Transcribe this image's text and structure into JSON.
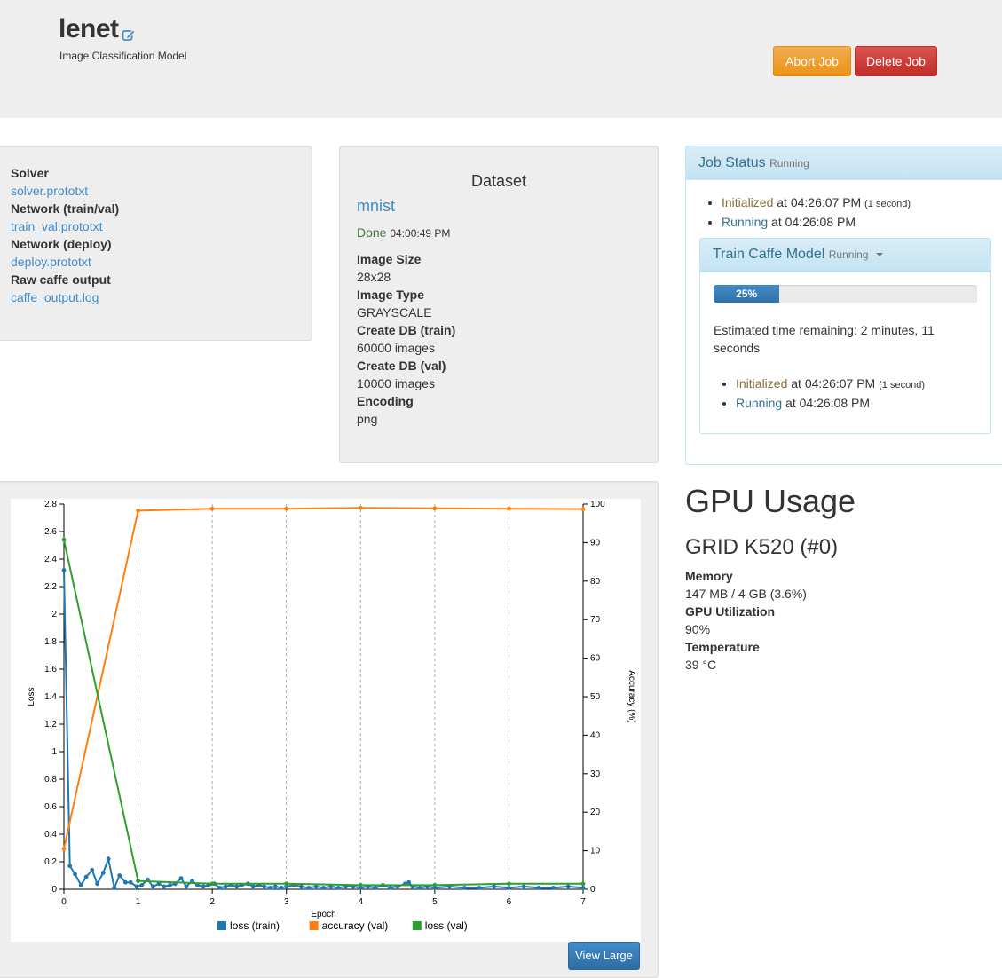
{
  "header": {
    "title": "lenet",
    "subtitle": "Image Classification Model",
    "abort_label": "Abort Job",
    "delete_label": "Delete Job"
  },
  "files": [
    {
      "label": "Solver",
      "link": "solver.prototxt"
    },
    {
      "label": "Network (train/val)",
      "link": "train_val.prototxt"
    },
    {
      "label": "Network (deploy)",
      "link": "deploy.prototxt"
    },
    {
      "label": "Raw caffe output",
      "link": "caffe_output.log"
    }
  ],
  "dataset": {
    "heading": "Dataset",
    "name": "mnist",
    "status": "Done",
    "status_time": "04:00:49 PM",
    "props": [
      {
        "label": "Image Size",
        "value": "28x28"
      },
      {
        "label": "Image Type",
        "value": "GRAYSCALE"
      },
      {
        "label": "Create DB (train)",
        "value": "60000 images"
      },
      {
        "label": "Create DB (val)",
        "value": "10000 images"
      },
      {
        "label": "Encoding",
        "value": "png"
      }
    ]
  },
  "job_status": {
    "title": "Job Status",
    "state": "Running",
    "events": [
      {
        "status": "Initialized",
        "time": "at 04:26:07 PM",
        "duration": "(1 second)"
      },
      {
        "status": "Running",
        "time": "at 04:26:08 PM",
        "duration": ""
      }
    ],
    "task": {
      "title": "Train Caffe Model",
      "state": "Running",
      "progress": 25,
      "progress_label": "25%",
      "eta": "Estimated time remaining: 2 minutes, 11 seconds",
      "events": [
        {
          "status": "Initialized",
          "time": "at 04:26:07 PM",
          "duration": "(1 second)"
        },
        {
          "status": "Running",
          "time": "at 04:26:08 PM",
          "duration": ""
        }
      ]
    }
  },
  "gpu": {
    "heading": "GPU Usage",
    "name": "GRID K520 (#0)",
    "props": [
      {
        "label": "Memory",
        "value": "147 MB / 4 GB (3.6%)"
      },
      {
        "label": "GPU Utilization",
        "value": "90%"
      },
      {
        "label": "Temperature",
        "value": "39 °C"
      }
    ]
  },
  "view_large_label": "View Large",
  "icons": {
    "edit": "edit-icon"
  },
  "colors": {
    "loss_train": "#1f77b4",
    "accuracy_val": "#ff7f0e",
    "loss_val": "#2ca02c"
  },
  "chart_data": {
    "type": "line",
    "xlabel": "Epoch",
    "ylabel": "Loss",
    "y2label": "Accuracy (%)",
    "xlim": [
      0,
      7
    ],
    "ylim": [
      0,
      2.8
    ],
    "y2lim": [
      0,
      100
    ],
    "xticks": [
      "0",
      "1",
      "2",
      "3",
      "4",
      "5",
      "6",
      "7"
    ],
    "yticks": [
      "0",
      "0.2",
      "0.4",
      "0.6",
      "0.8",
      "1",
      "1.2",
      "1.4",
      "1.6",
      "1.8",
      "2",
      "2.2",
      "2.4",
      "2.6",
      "2.8"
    ],
    "y2ticks": [
      "0",
      "10",
      "20",
      "30",
      "40",
      "50",
      "60",
      "70",
      "80",
      "90",
      "100"
    ],
    "vertical_grid": "dashed at each epoch",
    "legend_position": "bottom",
    "series": [
      {
        "name": "loss (train)",
        "axis": "left",
        "x": [
          0,
          0.08,
          0.15,
          0.23,
          0.3,
          0.38,
          0.45,
          0.53,
          0.6,
          0.68,
          0.75,
          0.83,
          0.9,
          0.98,
          1.05,
          1.13,
          1.2,
          1.28,
          1.35,
          1.43,
          1.5,
          1.58,
          1.65,
          1.73,
          1.8,
          1.88,
          1.95,
          2.03,
          2.1,
          2.18,
          2.25,
          2.33,
          2.4,
          2.48,
          2.55,
          2.63,
          2.7,
          2.78,
          2.85,
          2.93,
          3.0,
          3.1,
          3.2,
          3.3,
          3.4,
          3.5,
          3.6,
          3.7,
          3.8,
          3.9,
          4.0,
          4.1,
          4.2,
          4.3,
          4.4,
          4.5,
          4.6,
          4.65,
          4.7,
          4.8,
          4.9,
          5.0,
          5.2,
          5.4,
          5.6,
          5.8,
          6.0,
          6.2,
          6.4,
          6.6,
          6.8,
          7.0
        ],
        "y": [
          2.32,
          0.17,
          0.11,
          0.03,
          0.09,
          0.14,
          0.04,
          0.12,
          0.22,
          0.01,
          0.1,
          0.05,
          0.05,
          0.02,
          0.03,
          0.07,
          0.02,
          0.04,
          0.02,
          0.03,
          0.04,
          0.08,
          0.02,
          0.06,
          0.03,
          0.02,
          0.03,
          0.04,
          0.01,
          0.02,
          0.03,
          0.02,
          0.03,
          0.04,
          0.02,
          0.03,
          0.02,
          0.01,
          0.02,
          0.01,
          0.02,
          0.03,
          0.02,
          0.01,
          0.02,
          0.01,
          0.02,
          0.01,
          0.02,
          0.02,
          0.01,
          0.02,
          0.01,
          0.03,
          0.01,
          0.02,
          0.04,
          0.05,
          0.02,
          0.01,
          0.02,
          0.01,
          0.02,
          0.01,
          0.01,
          0.02,
          0.01,
          0.02,
          0.01,
          0.01,
          0.02,
          0.01
        ]
      },
      {
        "name": "accuracy (val)",
        "axis": "right",
        "x": [
          0,
          1,
          2,
          3,
          4,
          5,
          6,
          7
        ],
        "y": [
          10.5,
          98.3,
          98.8,
          98.8,
          99.0,
          98.9,
          98.8,
          98.7
        ]
      },
      {
        "name": "loss (val)",
        "axis": "left",
        "x": [
          0,
          1,
          2,
          3,
          4,
          5,
          6,
          7
        ],
        "y": [
          2.54,
          0.06,
          0.04,
          0.04,
          0.03,
          0.03,
          0.04,
          0.04
        ]
      }
    ]
  }
}
